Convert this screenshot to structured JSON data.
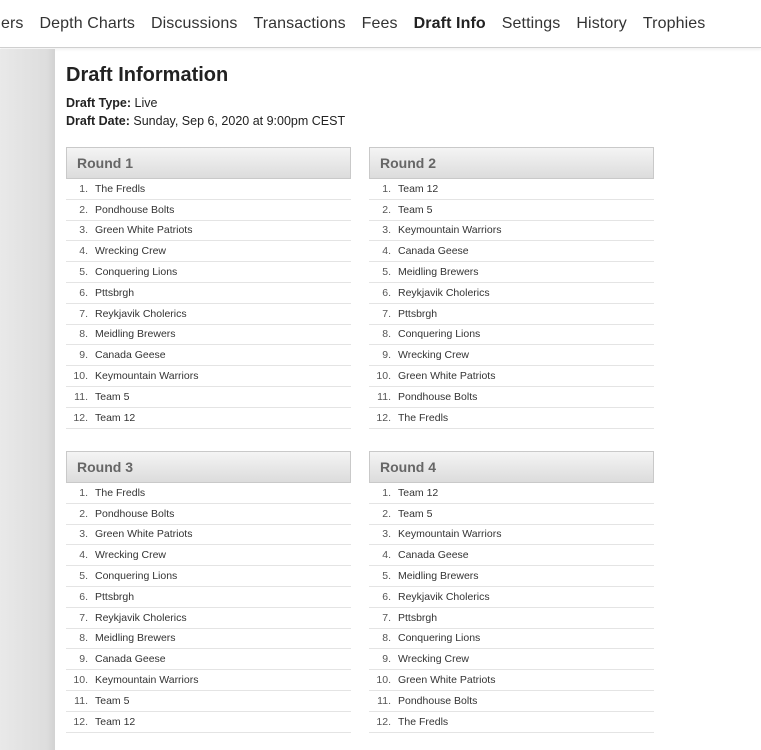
{
  "nav": {
    "items": [
      {
        "label": "hers",
        "active": false
      },
      {
        "label": "Depth Charts",
        "active": false
      },
      {
        "label": "Discussions",
        "active": false
      },
      {
        "label": "Transactions",
        "active": false
      },
      {
        "label": "Fees",
        "active": false
      },
      {
        "label": "Draft Info",
        "active": true
      },
      {
        "label": "Settings",
        "active": false
      },
      {
        "label": "History",
        "active": false
      },
      {
        "label": "Trophies",
        "active": false
      }
    ]
  },
  "page": {
    "title": "Draft Information",
    "draft_type_label": "Draft Type:",
    "draft_type_value": "Live",
    "draft_date_label": "Draft Date:",
    "draft_date_value": "Sunday, Sep 6, 2020 at 9:00pm CEST"
  },
  "rounds": [
    {
      "title": "Round 1",
      "picks": [
        {
          "n": "1.",
          "team": "The Fredls"
        },
        {
          "n": "2.",
          "team": "Pondhouse Bolts"
        },
        {
          "n": "3.",
          "team": "Green White Patriots"
        },
        {
          "n": "4.",
          "team": "Wrecking Crew"
        },
        {
          "n": "5.",
          "team": "Conquering Lions"
        },
        {
          "n": "6.",
          "team": "Pttsbrgh"
        },
        {
          "n": "7.",
          "team": "Reykjavik Cholerics"
        },
        {
          "n": "8.",
          "team": "Meidling Brewers"
        },
        {
          "n": "9.",
          "team": "Canada Geese"
        },
        {
          "n": "10.",
          "team": "Keymountain Warriors"
        },
        {
          "n": "11.",
          "team": "Team 5"
        },
        {
          "n": "12.",
          "team": "Team 12"
        }
      ]
    },
    {
      "title": "Round 2",
      "picks": [
        {
          "n": "1.",
          "team": "Team 12"
        },
        {
          "n": "2.",
          "team": "Team 5"
        },
        {
          "n": "3.",
          "team": "Keymountain Warriors"
        },
        {
          "n": "4.",
          "team": "Canada Geese"
        },
        {
          "n": "5.",
          "team": "Meidling Brewers"
        },
        {
          "n": "6.",
          "team": "Reykjavik Cholerics"
        },
        {
          "n": "7.",
          "team": "Pttsbrgh"
        },
        {
          "n": "8.",
          "team": "Conquering Lions"
        },
        {
          "n": "9.",
          "team": "Wrecking Crew"
        },
        {
          "n": "10.",
          "team": "Green White Patriots"
        },
        {
          "n": "11.",
          "team": "Pondhouse Bolts"
        },
        {
          "n": "12.",
          "team": "The Fredls"
        }
      ]
    },
    {
      "title": "Round 3",
      "picks": [
        {
          "n": "1.",
          "team": "The Fredls"
        },
        {
          "n": "2.",
          "team": "Pondhouse Bolts"
        },
        {
          "n": "3.",
          "team": "Green White Patriots"
        },
        {
          "n": "4.",
          "team": "Wrecking Crew"
        },
        {
          "n": "5.",
          "team": "Conquering Lions"
        },
        {
          "n": "6.",
          "team": "Pttsbrgh"
        },
        {
          "n": "7.",
          "team": "Reykjavik Cholerics"
        },
        {
          "n": "8.",
          "team": "Meidling Brewers"
        },
        {
          "n": "9.",
          "team": "Canada Geese"
        },
        {
          "n": "10.",
          "team": "Keymountain Warriors"
        },
        {
          "n": "11.",
          "team": "Team 5"
        },
        {
          "n": "12.",
          "team": "Team 12"
        }
      ]
    },
    {
      "title": "Round 4",
      "picks": [
        {
          "n": "1.",
          "team": "Team 12"
        },
        {
          "n": "2.",
          "team": "Team 5"
        },
        {
          "n": "3.",
          "team": "Keymountain Warriors"
        },
        {
          "n": "4.",
          "team": "Canada Geese"
        },
        {
          "n": "5.",
          "team": "Meidling Brewers"
        },
        {
          "n": "6.",
          "team": "Reykjavik Cholerics"
        },
        {
          "n": "7.",
          "team": "Pttsbrgh"
        },
        {
          "n": "8.",
          "team": "Conquering Lions"
        },
        {
          "n": "9.",
          "team": "Wrecking Crew"
        },
        {
          "n": "10.",
          "team": "Green White Patriots"
        },
        {
          "n": "11.",
          "team": "Pondhouse Bolts"
        },
        {
          "n": "12.",
          "team": "The Fredls"
        }
      ]
    }
  ]
}
